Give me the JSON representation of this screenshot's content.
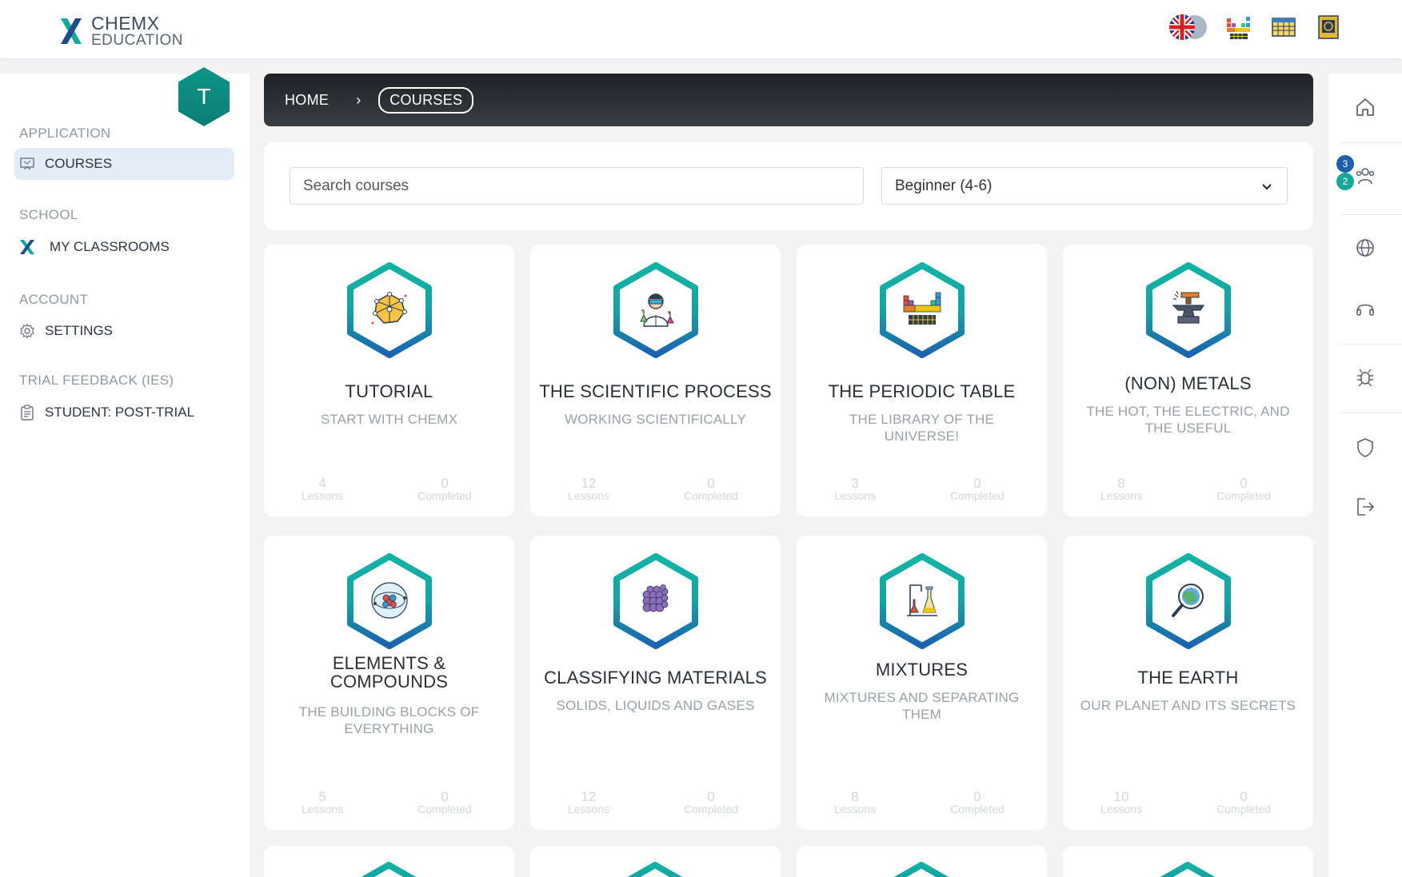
{
  "app": {
    "logo_main": "CHEMX",
    "logo_sub": "EDUCATION",
    "avatar_initial": "T"
  },
  "colors": {
    "teal": "#10a39a",
    "blue": "#1d6bb3",
    "dark": "#2a2d31"
  },
  "top_icons": [
    "uk-flag-icon",
    "periodic-table-icon",
    "grid-table-icon",
    "book-icon"
  ],
  "sidebar": {
    "sections": [
      {
        "title": "APPLICATION",
        "items": [
          {
            "label": "COURSES",
            "icon": "presentation-icon",
            "active": true
          }
        ]
      },
      {
        "title": "SCHOOL",
        "items": [
          {
            "label": "MY CLASSROOMS",
            "icon": "chemx-logo-icon",
            "active": false
          }
        ]
      },
      {
        "title": "ACCOUNT",
        "items": [
          {
            "label": "SETTINGS",
            "icon": "gear-icon",
            "active": false
          }
        ]
      },
      {
        "title": "TRIAL FEEDBACK (IES)",
        "items": [
          {
            "label": "STUDENT: POST-TRIAL",
            "icon": "clipboard-icon",
            "active": false
          }
        ]
      }
    ]
  },
  "right_rail": {
    "icons": [
      "home-icon",
      "users-icon",
      "globe-icon",
      "headset-icon",
      "bug-icon",
      "shield-icon",
      "logout-icon"
    ],
    "badges": [
      "3",
      "2"
    ]
  },
  "breadcrumb": {
    "home": "HOME",
    "separator": "›",
    "current": "COURSES"
  },
  "filters": {
    "search_placeholder": "Search courses",
    "level_selected": "Beginner (4-6)"
  },
  "courses": [
    {
      "title": "TUTORIAL",
      "subtitle": "START WITH CHEMX",
      "lessons": "4",
      "completed": "0",
      "icon": "brain-network-icon"
    },
    {
      "title": "THE SCIENTIFIC PROCESS",
      "subtitle": "WORKING SCIENTIFICALLY",
      "lessons": "12",
      "completed": "0",
      "icon": "scientist-icon"
    },
    {
      "title": "THE PERIODIC TABLE",
      "subtitle": "THE LIBRARY OF THE UNIVERSE!",
      "lessons": "3",
      "completed": "0",
      "icon": "periodic-table-icon"
    },
    {
      "title": "(NON) METALS",
      "subtitle": "THE HOT, THE ELECTRIC, AND THE USEFUL",
      "lessons": "8",
      "completed": "0",
      "icon": "anvil-icon"
    },
    {
      "title": "ELEMENTS & COMPOUNDS",
      "subtitle": "THE BUILDING BLOCKS OF EVERYTHING",
      "lessons": "5",
      "completed": "0",
      "icon": "atom-icon"
    },
    {
      "title": "CLASSIFYING MATERIALS",
      "subtitle": "SOLIDS, LIQUIDS AND GASES",
      "lessons": "12",
      "completed": "0",
      "icon": "particle-cube-icon"
    },
    {
      "title": "MIXTURES",
      "subtitle": "MIXTURES AND SEPARATING THEM",
      "lessons": "8",
      "completed": "0",
      "icon": "lab-flasks-icon"
    },
    {
      "title": "THE EARTH",
      "subtitle": "OUR PLANET AND ITS SECRETS",
      "lessons": "10",
      "completed": "0",
      "icon": "earth-magnifier-icon"
    }
  ],
  "labels": {
    "lessons": "Lessons",
    "completed": "Completed"
  }
}
